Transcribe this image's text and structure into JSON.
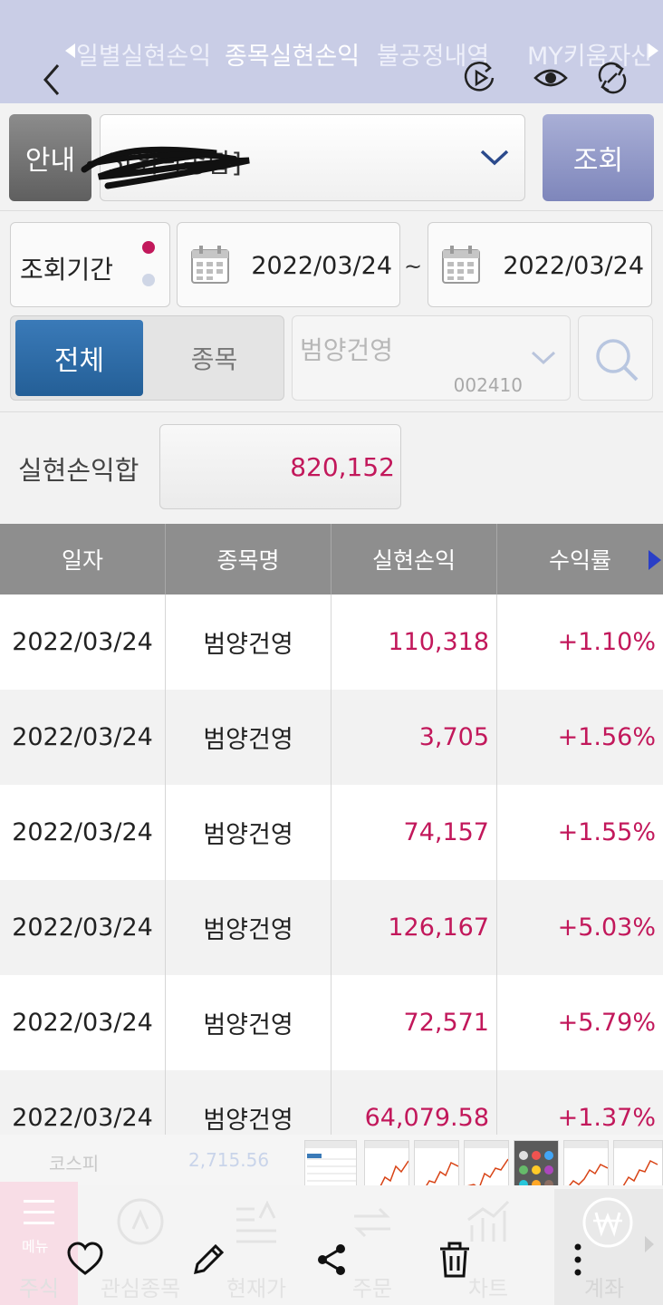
{
  "header": {
    "tabs": [
      {
        "label": "일별실현손익",
        "active": false
      },
      {
        "label": "종목실현손익",
        "active": true
      },
      {
        "label": "불공정내역",
        "active": false
      },
      {
        "label": "MY키움자산",
        "active": false
      }
    ],
    "icons": [
      "play-circle-icon",
      "eye-icon",
      "sync-icon"
    ]
  },
  "account": {
    "guide_label": "안내",
    "account_text": "5[위탁종합]",
    "query_label": "조회"
  },
  "period": {
    "label": "조회기간",
    "start": "2022/03/24",
    "separator": "~",
    "end": "2022/03/24"
  },
  "filter": {
    "all_label": "전체",
    "stock_label": "종목",
    "stock_name": "범양건영",
    "stock_code": "002410"
  },
  "total": {
    "label": "실현손익합",
    "value": "820,152"
  },
  "table": {
    "headers": [
      "일자",
      "종목명",
      "실현손익",
      "수익률"
    ],
    "rows": [
      {
        "date": "2022/03/24",
        "name": "범양건영",
        "pl": "110,318",
        "rate": "+1.10%"
      },
      {
        "date": "2022/03/24",
        "name": "범양건영",
        "pl": "3,705",
        "rate": "+1.56%"
      },
      {
        "date": "2022/03/24",
        "name": "범양건영",
        "pl": "74,157",
        "rate": "+1.55%"
      },
      {
        "date": "2022/03/24",
        "name": "범양건영",
        "pl": "126,167",
        "rate": "+5.03%"
      },
      {
        "date": "2022/03/24",
        "name": "범양건영",
        "pl": "72,571",
        "rate": "+5.79%"
      },
      {
        "date": "2022/03/24",
        "name": "범양건영",
        "pl": "64,079.58",
        "rate": "+1.37%"
      }
    ]
  },
  "ticker": {
    "index_name": "코스피",
    "index_value": "2,715.56"
  },
  "bottom_nav": {
    "menu_label": "메뉴",
    "items": [
      "주식",
      "관심종목",
      "현재가",
      "주문",
      "차트",
      "계좌"
    ]
  },
  "actions": [
    "heart-icon",
    "edit-icon",
    "share-icon",
    "delete-icon",
    "more-icon"
  ],
  "colors": {
    "header_bg": "#c9cde6",
    "profit": "#c2185b",
    "primary_button": "#2d6aa6",
    "table_header": "#8e8e8e"
  }
}
